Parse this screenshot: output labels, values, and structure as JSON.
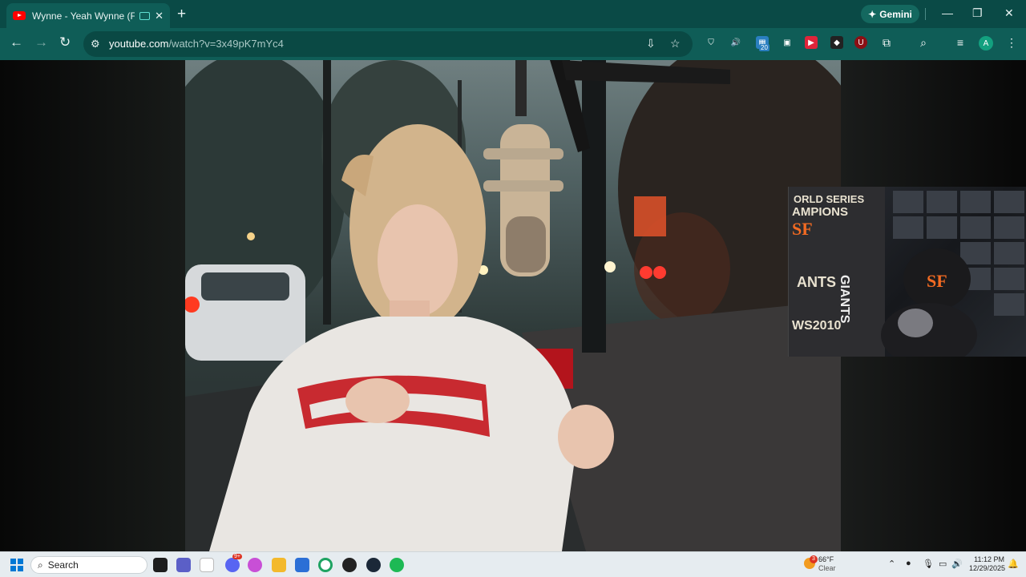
{
  "browser": {
    "tab": {
      "title": "Wynne - Yeah Wynne (From",
      "favicon": "youtube-icon",
      "media_indicator": "picture-in-picture-icon",
      "close_label": "✕"
    },
    "new_tab_label": "+",
    "gemini_label": "Gemini",
    "window_controls": {
      "minimize": "—",
      "restore": "❐",
      "close": "✕"
    },
    "nav": {
      "back": "←",
      "forward": "→",
      "reload": "↻"
    },
    "address": {
      "host": "youtube.com",
      "path": "/watch?v=3x49pK7mYc4"
    },
    "extensions": [
      {
        "name": "shield-extension-icon",
        "glyph": "⛉"
      },
      {
        "name": "volume-extension-icon",
        "glyph": "🔊"
      },
      {
        "name": "counter-extension-icon",
        "glyph": "▦",
        "badge": "20"
      },
      {
        "name": "pip-extension-icon",
        "glyph": "▣"
      },
      {
        "name": "red-extension-icon",
        "glyph": "▶"
      },
      {
        "name": "dark-extension-icon",
        "glyph": "◆"
      },
      {
        "name": "ublock-extension-icon",
        "glyph": "U"
      },
      {
        "name": "puzzle-extension-icon",
        "glyph": "⧉"
      }
    ],
    "avatar_letter": "A"
  },
  "taskbar": {
    "search_label": "Search",
    "weather": {
      "temp": "66°F",
      "condition": "Clear",
      "badge": "3"
    },
    "clock": {
      "time": "11:12 PM",
      "date": "12/29/2025"
    },
    "apps": [
      "task-view",
      "copilot",
      "meta",
      "discord",
      "colors",
      "file-explorer",
      "store",
      "chrome",
      "record",
      "steam",
      "spotify"
    ],
    "discord_badge": "9+"
  },
  "colors": {
    "title_bar": "#0a4a46",
    "toolbar": "#0f5d57",
    "taskbar": "#e6ecf0"
  }
}
